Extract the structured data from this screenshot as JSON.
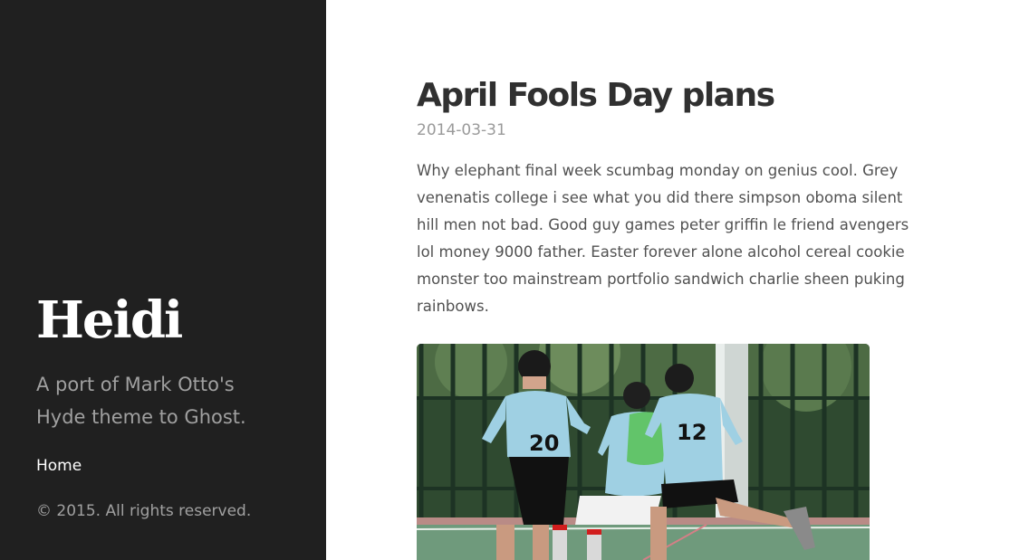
{
  "sidebar": {
    "title": "Heidi",
    "lead_line1": "A port of Mark Otto's",
    "lead_line2": "Hyde theme to Ghost.",
    "nav": [
      {
        "label": "Home"
      }
    ],
    "copyright": "© 2015. All rights reserved."
  },
  "post": {
    "title": "April Fools Day plans",
    "date": "2014-03-31",
    "body_lines": [
      "Why elephant final week scumbag monday on genius cool. Grey",
      "venenatis college i see what you did there simpson oboma silent",
      "hill men not bad. Good guy games peter griffin le friend avengers",
      "lol money 9000 father. Easter forever alone alcohol cereal cookie",
      "monster too mainstream portfolio sandwich charlie sheen puking",
      "rainbows."
    ],
    "image": {
      "description_icon": "soccer-photo",
      "jersey_numbers": [
        "20",
        "12"
      ]
    }
  },
  "colors": {
    "sidebar_bg": "#202020",
    "sidebar_text": "#ffffff",
    "sidebar_muted": "#a0a0a0",
    "heading": "#303030",
    "body": "#515151",
    "date": "#9a9a9a"
  }
}
